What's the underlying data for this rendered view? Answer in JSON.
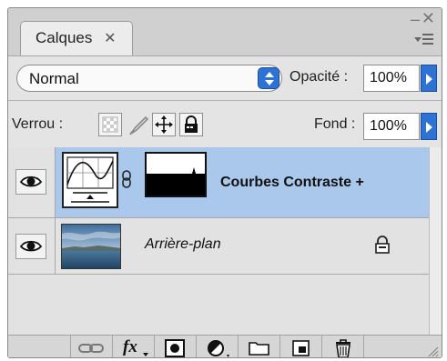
{
  "tab": {
    "label": "Calques",
    "close_glyph": "✕"
  },
  "window": {
    "minimize_glyph": "–",
    "close_glyph": "✕"
  },
  "blend_mode": {
    "value": "Normal"
  },
  "opacity": {
    "label": "Opacité :",
    "value": "100%"
  },
  "lock": {
    "label": "Verrou :",
    "icons": [
      "lock-transparent-icon",
      "lock-brush-icon",
      "lock-move-icon",
      "lock-all-icon"
    ]
  },
  "fill": {
    "label": "Fond :",
    "value": "100%"
  },
  "layers": [
    {
      "name": "Courbes Contraste +",
      "type": "adjustment-curves",
      "visible": true,
      "selected": true,
      "locked": false
    },
    {
      "name": "Arrière-plan",
      "type": "background",
      "visible": true,
      "selected": false,
      "locked": true
    }
  ],
  "toolbar": {
    "icons": [
      "link-layers-icon",
      "fx-icon",
      "layer-mask-icon",
      "adjustment-layer-icon",
      "group-folder-icon",
      "new-layer-icon",
      "trash-icon"
    ],
    "fx_label": "fx"
  },
  "colors": {
    "selection": "#a9c8ec",
    "accent": "#2d73d6"
  }
}
